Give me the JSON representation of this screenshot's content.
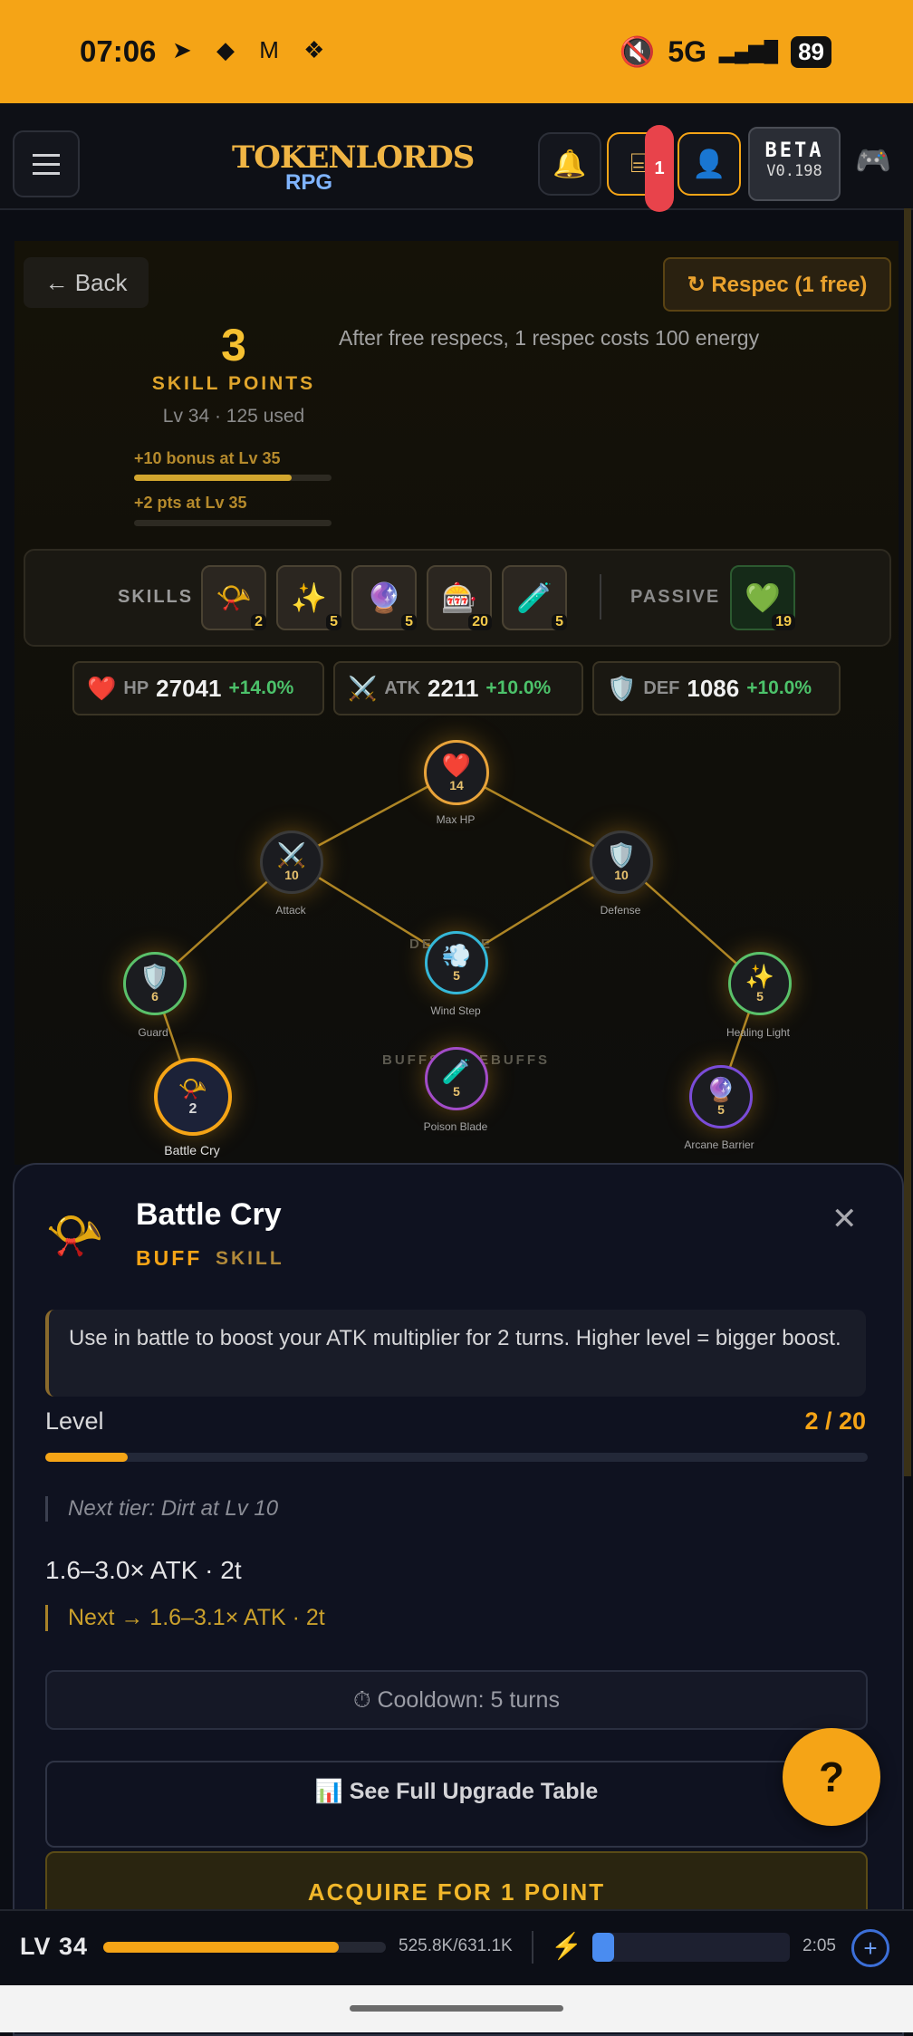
{
  "status_bar": {
    "time": "07:06",
    "notification_icons": "➤ ◆ M ❖",
    "mute_icon": "🔇",
    "network": "5G",
    "signal_icon": "▂▄▆█",
    "battery": "89"
  },
  "header": {
    "logo_title": "TOKENLORDS",
    "logo_sub": "RPG",
    "notif_count": "1",
    "beta_label": "BETA",
    "beta_version": "V0.198"
  },
  "panel": {
    "back_label": "← Back",
    "respec_label": "↻ Respec (1 free)",
    "respec_info": "After free respecs, 1 respec costs 100 energy",
    "skill_points": "3",
    "skill_points_label": "SKILL POINTS",
    "level_used": "Lv 34 · 125 used",
    "bonus_1": "+10 bonus at Lv 35",
    "bonus_1_progress": 0.8,
    "bonus_2": "+2 pts at Lv 35",
    "bonus_2_progress": 0.0
  },
  "skills_bar": {
    "skills_label": "SKILLS",
    "passive_label": "PASSIVE",
    "skills": [
      {
        "icon": "📯",
        "level": "2"
      },
      {
        "icon": "✨",
        "level": "5"
      },
      {
        "icon": "🔮",
        "level": "5"
      },
      {
        "icon": "🎰",
        "level": "20"
      },
      {
        "icon": "🧪",
        "level": "5"
      }
    ],
    "passive": {
      "icon": "💚",
      "level": "19"
    }
  },
  "stats": [
    {
      "icon": "❤️",
      "name": "HP",
      "value": "27041",
      "bonus": "+14.0%"
    },
    {
      "icon": "⚔️",
      "name": "ATK",
      "value": "2211",
      "bonus": "+10.0%"
    },
    {
      "icon": "🛡️",
      "name": "DEF",
      "value": "1086",
      "bonus": "+10.0%"
    }
  ],
  "tree": {
    "ghost_labels": [
      "DEFENSE",
      "BUFFS & DEBUFFS"
    ],
    "nodes": [
      {
        "key": "max_hp",
        "icon": "❤️",
        "level": "14",
        "label": "Max HP",
        "ring": "#e8a33a"
      },
      {
        "key": "attack",
        "icon": "⚔️",
        "level": "10",
        "label": "Attack",
        "ring": "#3a3a3a"
      },
      {
        "key": "defense",
        "icon": "🛡️",
        "level": "10",
        "label": "Defense",
        "ring": "#3a3a3a"
      },
      {
        "key": "guard",
        "icon": "🛡️",
        "level": "6",
        "label": "Guard",
        "ring": "#5ac16a"
      },
      {
        "key": "wind_step",
        "icon": "💨",
        "level": "5",
        "label": "Wind Step",
        "ring": "#35b8d8"
      },
      {
        "key": "healing_light",
        "icon": "✨",
        "level": "5",
        "label": "Healing Light",
        "ring": "#5ac16a"
      },
      {
        "key": "battle_cry",
        "icon": "📯",
        "level": "2",
        "label": "Battle Cry",
        "ring": "#f5a416"
      },
      {
        "key": "poison_blade",
        "icon": "🧪",
        "level": "5",
        "label": "Poison Blade",
        "ring": "#a24cc8"
      },
      {
        "key": "arcane_barrier",
        "icon": "🔮",
        "level": "5",
        "label": "Arcane Barrier",
        "ring": "#7a4cd8"
      }
    ]
  },
  "sheet": {
    "icon": "📯",
    "title": "Battle Cry",
    "type": "BUFF",
    "category": "SKILL",
    "close_icon": "✕",
    "description": "Use in battle to boost your ATK multiplier for 2 turns. Higher level = bigger boost.",
    "level_label": "Level",
    "level_value": "2 / 20",
    "level_progress": 0.1,
    "next_tier": "Next tier: Dirt at Lv 10",
    "effect": "1.6–3.0× ATK · 2t",
    "next_effect": "Next → 1.6–3.1× ATK · 2t",
    "cooldown": "⏱ Cooldown: 5 turns",
    "full_table": "📊 See Full Upgrade Table",
    "acquire": "ACQUIRE FOR 1 POINT"
  },
  "help_label": "?",
  "bottom_bar": {
    "level": "LV 34",
    "xp_text": "525.8K/631.1K",
    "xp_progress": 0.833,
    "bolt_icon": "⚡",
    "energy_progress": 0.11,
    "timer": "2:05",
    "plus_label": "+"
  }
}
